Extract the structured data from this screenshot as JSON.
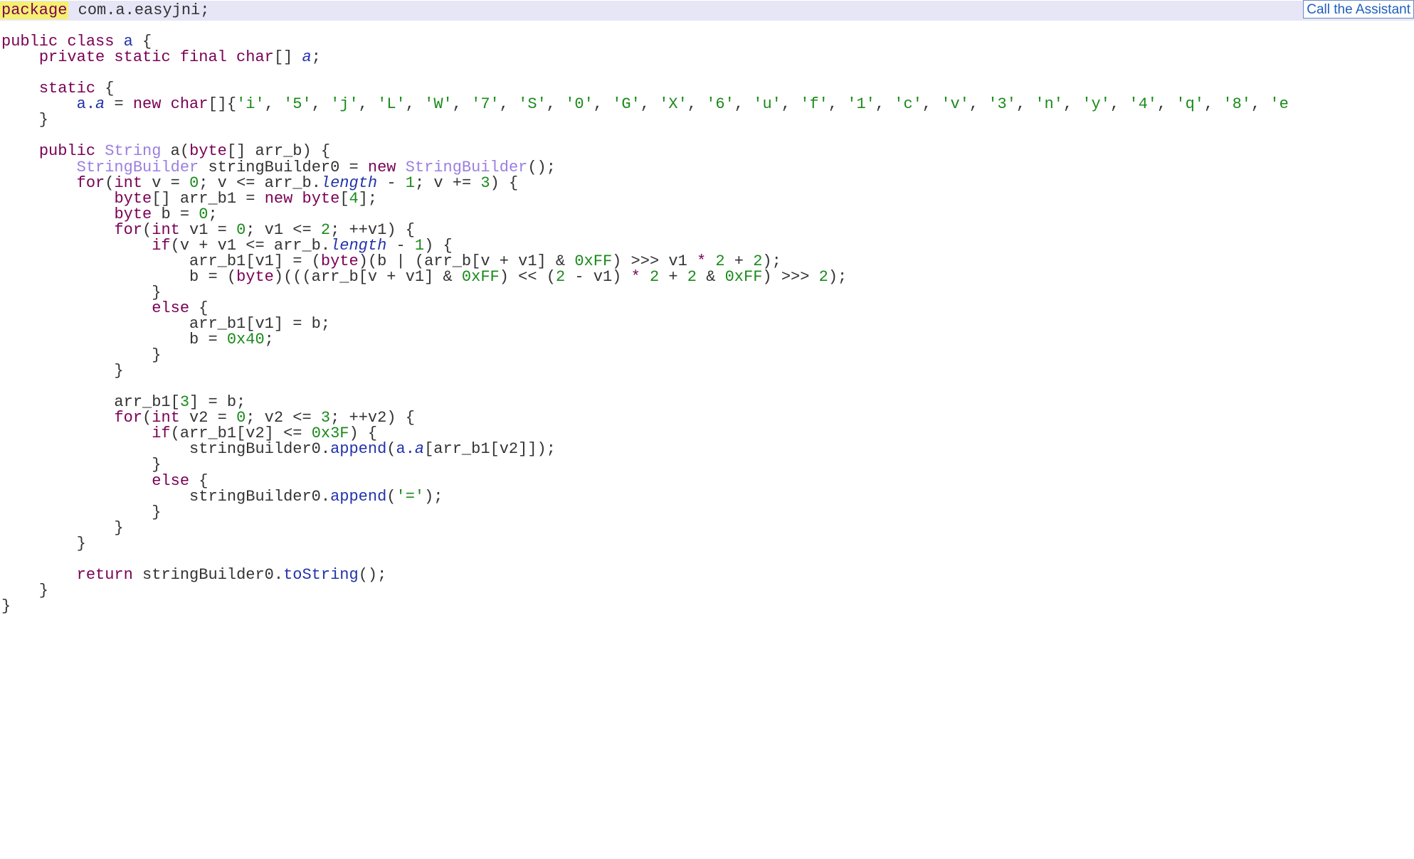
{
  "assistant_button": {
    "label": "Call the Assistant"
  },
  "code_lines": [
    [
      {
        "t": "kw",
        "v": "package",
        "hl": true
      },
      {
        "t": "p",
        "v": " com.a.easyjni;"
      }
    ],
    [],
    [
      {
        "t": "kw",
        "v": "public class "
      },
      {
        "t": "fld",
        "v": "a"
      },
      {
        "t": "p",
        "v": " {"
      }
    ],
    [
      {
        "t": "p",
        "v": "    "
      },
      {
        "t": "kw",
        "v": "private static final char"
      },
      {
        "t": "p",
        "v": "[] "
      },
      {
        "t": "ital",
        "v": "a"
      },
      {
        "t": "p",
        "v": ";"
      }
    ],
    [],
    [
      {
        "t": "p",
        "v": "    "
      },
      {
        "t": "kw",
        "v": "static"
      },
      {
        "t": "p",
        "v": " {"
      }
    ],
    [
      {
        "t": "p",
        "v": "        "
      },
      {
        "t": "fld",
        "v": "a."
      },
      {
        "t": "ital",
        "v": "a"
      },
      {
        "t": "p",
        "v": " = "
      },
      {
        "t": "kw",
        "v": "new char"
      },
      {
        "t": "p",
        "v": "[]{"
      },
      {
        "t": "str",
        "v": "'i'"
      },
      {
        "t": "p",
        "v": ", "
      },
      {
        "t": "str",
        "v": "'5'"
      },
      {
        "t": "p",
        "v": ", "
      },
      {
        "t": "str",
        "v": "'j'"
      },
      {
        "t": "p",
        "v": ", "
      },
      {
        "t": "str",
        "v": "'L'"
      },
      {
        "t": "p",
        "v": ", "
      },
      {
        "t": "str",
        "v": "'W'"
      },
      {
        "t": "p",
        "v": ", "
      },
      {
        "t": "str",
        "v": "'7'"
      },
      {
        "t": "p",
        "v": ", "
      },
      {
        "t": "str",
        "v": "'S'"
      },
      {
        "t": "p",
        "v": ", "
      },
      {
        "t": "str",
        "v": "'0'"
      },
      {
        "t": "p",
        "v": ", "
      },
      {
        "t": "str",
        "v": "'G'"
      },
      {
        "t": "p",
        "v": ", "
      },
      {
        "t": "str",
        "v": "'X'"
      },
      {
        "t": "p",
        "v": ", "
      },
      {
        "t": "str",
        "v": "'6'"
      },
      {
        "t": "p",
        "v": ", "
      },
      {
        "t": "str",
        "v": "'u'"
      },
      {
        "t": "p",
        "v": ", "
      },
      {
        "t": "str",
        "v": "'f'"
      },
      {
        "t": "p",
        "v": ", "
      },
      {
        "t": "str",
        "v": "'1'"
      },
      {
        "t": "p",
        "v": ", "
      },
      {
        "t": "str",
        "v": "'c'"
      },
      {
        "t": "p",
        "v": ", "
      },
      {
        "t": "str",
        "v": "'v'"
      },
      {
        "t": "p",
        "v": ", "
      },
      {
        "t": "str",
        "v": "'3'"
      },
      {
        "t": "p",
        "v": ", "
      },
      {
        "t": "str",
        "v": "'n'"
      },
      {
        "t": "p",
        "v": ", "
      },
      {
        "t": "str",
        "v": "'y'"
      },
      {
        "t": "p",
        "v": ", "
      },
      {
        "t": "str",
        "v": "'4'"
      },
      {
        "t": "p",
        "v": ", "
      },
      {
        "t": "str",
        "v": "'q'"
      },
      {
        "t": "p",
        "v": ", "
      },
      {
        "t": "str",
        "v": "'8'"
      },
      {
        "t": "p",
        "v": ", "
      },
      {
        "t": "str",
        "v": "'e"
      }
    ],
    [
      {
        "t": "p",
        "v": "    }"
      }
    ],
    [],
    [
      {
        "t": "p",
        "v": "    "
      },
      {
        "t": "kw",
        "v": "public "
      },
      {
        "t": "type",
        "v": "String"
      },
      {
        "t": "p",
        "v": " a("
      },
      {
        "t": "kw",
        "v": "byte"
      },
      {
        "t": "p",
        "v": "[] arr_b) {"
      }
    ],
    [
      {
        "t": "p",
        "v": "        "
      },
      {
        "t": "type",
        "v": "StringBuilder"
      },
      {
        "t": "p",
        "v": " stringBuilder0 = "
      },
      {
        "t": "kw",
        "v": "new "
      },
      {
        "t": "type",
        "v": "StringBuilder"
      },
      {
        "t": "p",
        "v": "();"
      }
    ],
    [
      {
        "t": "p",
        "v": "        "
      },
      {
        "t": "kw",
        "v": "for"
      },
      {
        "t": "p",
        "v": "("
      },
      {
        "t": "kw",
        "v": "int"
      },
      {
        "t": "p",
        "v": " v = "
      },
      {
        "t": "num",
        "v": "0"
      },
      {
        "t": "p",
        "v": "; v <= arr_b."
      },
      {
        "t": "ital",
        "v": "length"
      },
      {
        "t": "p",
        "v": " - "
      },
      {
        "t": "num",
        "v": "1"
      },
      {
        "t": "p",
        "v": "; v += "
      },
      {
        "t": "num",
        "v": "3"
      },
      {
        "t": "p",
        "v": ") {"
      }
    ],
    [
      {
        "t": "p",
        "v": "            "
      },
      {
        "t": "kw",
        "v": "byte"
      },
      {
        "t": "p",
        "v": "[] arr_b1 = "
      },
      {
        "t": "kw",
        "v": "new byte"
      },
      {
        "t": "p",
        "v": "["
      },
      {
        "t": "num",
        "v": "4"
      },
      {
        "t": "p",
        "v": "];"
      }
    ],
    [
      {
        "t": "p",
        "v": "            "
      },
      {
        "t": "kw",
        "v": "byte"
      },
      {
        "t": "p",
        "v": " b = "
      },
      {
        "t": "num",
        "v": "0"
      },
      {
        "t": "p",
        "v": ";"
      }
    ],
    [
      {
        "t": "p",
        "v": "            "
      },
      {
        "t": "kw",
        "v": "for"
      },
      {
        "t": "p",
        "v": "("
      },
      {
        "t": "kw",
        "v": "int"
      },
      {
        "t": "p",
        "v": " v1 = "
      },
      {
        "t": "num",
        "v": "0"
      },
      {
        "t": "p",
        "v": "; v1 <= "
      },
      {
        "t": "num",
        "v": "2"
      },
      {
        "t": "p",
        "v": "; ++v1) {"
      }
    ],
    [
      {
        "t": "p",
        "v": "                "
      },
      {
        "t": "kw",
        "v": "if"
      },
      {
        "t": "p",
        "v": "(v + v1 <= arr_b."
      },
      {
        "t": "ital",
        "v": "length"
      },
      {
        "t": "p",
        "v": " - "
      },
      {
        "t": "num",
        "v": "1"
      },
      {
        "t": "p",
        "v": ") {"
      }
    ],
    [
      {
        "t": "p",
        "v": "                    arr_b1[v1] = ("
      },
      {
        "t": "kw",
        "v": "byte"
      },
      {
        "t": "p",
        "v": ")(b | (arr_b[v + v1] & "
      },
      {
        "t": "num",
        "v": "0xFF"
      },
      {
        "t": "p",
        "v": ") >>> v1 "
      },
      {
        "t": "kw",
        "v": "*"
      },
      {
        "t": "p",
        "v": " "
      },
      {
        "t": "num",
        "v": "2"
      },
      {
        "t": "p",
        "v": " + "
      },
      {
        "t": "num",
        "v": "2"
      },
      {
        "t": "p",
        "v": ");"
      }
    ],
    [
      {
        "t": "p",
        "v": "                    b = ("
      },
      {
        "t": "kw",
        "v": "byte"
      },
      {
        "t": "p",
        "v": ")(((arr_b[v + v1] & "
      },
      {
        "t": "num",
        "v": "0xFF"
      },
      {
        "t": "p",
        "v": ") << ("
      },
      {
        "t": "num",
        "v": "2"
      },
      {
        "t": "p",
        "v": " - v1) "
      },
      {
        "t": "kw",
        "v": "*"
      },
      {
        "t": "p",
        "v": " "
      },
      {
        "t": "num",
        "v": "2"
      },
      {
        "t": "p",
        "v": " + "
      },
      {
        "t": "num",
        "v": "2"
      },
      {
        "t": "p",
        "v": " & "
      },
      {
        "t": "num",
        "v": "0xFF"
      },
      {
        "t": "p",
        "v": ") >>> "
      },
      {
        "t": "num",
        "v": "2"
      },
      {
        "t": "p",
        "v": ");"
      }
    ],
    [
      {
        "t": "p",
        "v": "                }"
      }
    ],
    [
      {
        "t": "p",
        "v": "                "
      },
      {
        "t": "kw",
        "v": "else"
      },
      {
        "t": "p",
        "v": " {"
      }
    ],
    [
      {
        "t": "p",
        "v": "                    arr_b1[v1] = b;"
      }
    ],
    [
      {
        "t": "p",
        "v": "                    b = "
      },
      {
        "t": "num",
        "v": "0x40"
      },
      {
        "t": "p",
        "v": ";"
      }
    ],
    [
      {
        "t": "p",
        "v": "                }"
      }
    ],
    [
      {
        "t": "p",
        "v": "            }"
      }
    ],
    [],
    [
      {
        "t": "p",
        "v": "            arr_b1["
      },
      {
        "t": "num",
        "v": "3"
      },
      {
        "t": "p",
        "v": "] = b;"
      }
    ],
    [
      {
        "t": "p",
        "v": "            "
      },
      {
        "t": "kw",
        "v": "for"
      },
      {
        "t": "p",
        "v": "("
      },
      {
        "t": "kw",
        "v": "int"
      },
      {
        "t": "p",
        "v": " v2 = "
      },
      {
        "t": "num",
        "v": "0"
      },
      {
        "t": "p",
        "v": "; v2 <= "
      },
      {
        "t": "num",
        "v": "3"
      },
      {
        "t": "p",
        "v": "; ++v2) {"
      }
    ],
    [
      {
        "t": "p",
        "v": "                "
      },
      {
        "t": "kw",
        "v": "if"
      },
      {
        "t": "p",
        "v": "(arr_b1[v2] <= "
      },
      {
        "t": "num",
        "v": "0x3F"
      },
      {
        "t": "p",
        "v": ") {"
      }
    ],
    [
      {
        "t": "p",
        "v": "                    stringBuilder0."
      },
      {
        "t": "fld",
        "v": "append"
      },
      {
        "t": "p",
        "v": "("
      },
      {
        "t": "fld",
        "v": "a."
      },
      {
        "t": "ital",
        "v": "a"
      },
      {
        "t": "p",
        "v": "[arr_b1[v2]]);"
      }
    ],
    [
      {
        "t": "p",
        "v": "                }"
      }
    ],
    [
      {
        "t": "p",
        "v": "                "
      },
      {
        "t": "kw",
        "v": "else"
      },
      {
        "t": "p",
        "v": " {"
      }
    ],
    [
      {
        "t": "p",
        "v": "                    stringBuilder0."
      },
      {
        "t": "fld",
        "v": "append"
      },
      {
        "t": "p",
        "v": "("
      },
      {
        "t": "str",
        "v": "'='"
      },
      {
        "t": "p",
        "v": ");"
      }
    ],
    [
      {
        "t": "p",
        "v": "                }"
      }
    ],
    [
      {
        "t": "p",
        "v": "            }"
      }
    ],
    [
      {
        "t": "p",
        "v": "        }"
      }
    ],
    [],
    [
      {
        "t": "p",
        "v": "        "
      },
      {
        "t": "kw",
        "v": "return"
      },
      {
        "t": "p",
        "v": " stringBuilder0."
      },
      {
        "t": "fld",
        "v": "toString"
      },
      {
        "t": "p",
        "v": "();"
      }
    ],
    [
      {
        "t": "p",
        "v": "    }"
      }
    ],
    [
      {
        "t": "p",
        "v": "}"
      }
    ]
  ],
  "colors": {
    "keyword": "#7a0055",
    "type": "#9b7fe0",
    "number": "#1a8a1a",
    "member": "#2233aa",
    "highlight_line": "#e6e6f7",
    "package_highlight": "#f5f070"
  }
}
